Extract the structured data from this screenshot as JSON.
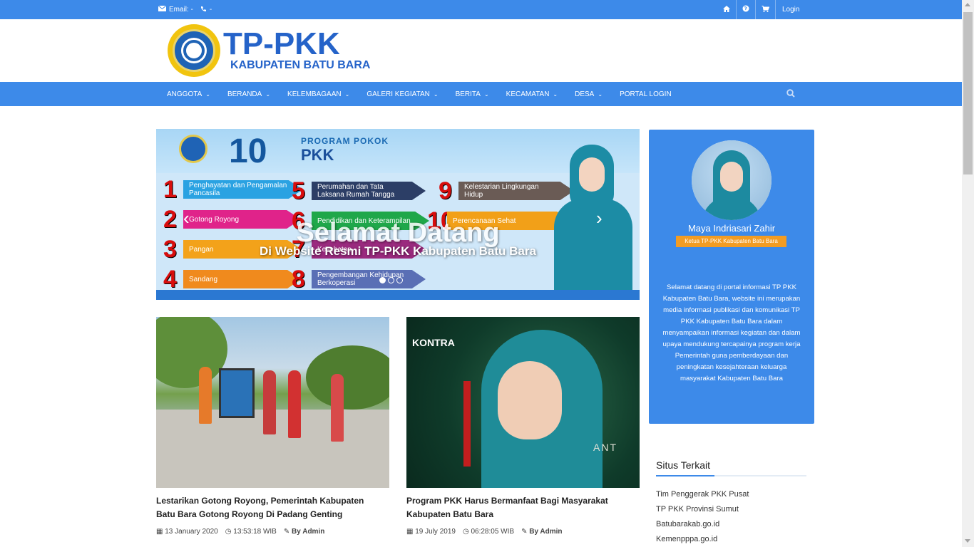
{
  "topbar": {
    "email_label": "Email: -",
    "phone_label": "-",
    "icons": [
      "home-icon",
      "globe-icon",
      "cart-icon"
    ],
    "login_label": "Login"
  },
  "logo": {
    "brand": "TP-PKK",
    "sub": "KABUPATEN BATU BARA"
  },
  "nav": {
    "items": [
      {
        "label": "ANGGOTA",
        "dropdown": true
      },
      {
        "label": "BERANDA",
        "dropdown": true
      },
      {
        "label": "KELEMBAGAAN",
        "dropdown": true
      },
      {
        "label": "GALERI KEGIATAN",
        "dropdown": true
      },
      {
        "label": "BERITA",
        "dropdown": true
      },
      {
        "label": "KECAMATAN",
        "dropdown": true
      },
      {
        "label": "DESA",
        "dropdown": true
      },
      {
        "label": "PORTAL LOGIN",
        "dropdown": false
      }
    ],
    "search_icon": "search-icon"
  },
  "slider": {
    "number": "10",
    "heading1": "PROGRAM POKOK",
    "heading2": "PKK",
    "programs": [
      {
        "n": "1",
        "label": "Penghayatan dan Pengamalan Pancasila",
        "color": "#2aa2e2"
      },
      {
        "n": "2",
        "label": "Gotong Royong",
        "color": "#e0238a"
      },
      {
        "n": "3",
        "label": "Pangan",
        "color": "#f3a21a"
      },
      {
        "n": "4",
        "label": "Sandang",
        "color": "#f08a1d"
      },
      {
        "n": "5",
        "label": "Perumahan dan Tata Laksana Rumah Tangga",
        "color": "#2c3e66"
      },
      {
        "n": "6",
        "label": "Pendidikan dan Keterampilan",
        "color": "#1fa74a"
      },
      {
        "n": "7",
        "label": "Kesehatan",
        "color": "#9a2a7e"
      },
      {
        "n": "8",
        "label": "Pengembangan Kehidupan Berkoperasi",
        "color": "#5a6fb5"
      },
      {
        "n": "9",
        "label": "Kelestarian Lingkungan Hidup",
        "color": "#6a5b55"
      },
      {
        "n": "10",
        "label": "Perencanaan Sehat",
        "color": "#f2a018"
      }
    ],
    "caption_title": "Selamat Datang",
    "caption_sub": "Di Website Resmi TP-PKK Kabupaten Batu Bara",
    "active_slide": 1,
    "slide_count": 3
  },
  "posts": [
    {
      "title": "Lestarikan Gotong Royong, Pemerintah Kabupaten Batu Bara Gotong Royong Di Padang Genting",
      "date": "13 January 2020",
      "time": "13:53:18 WIB",
      "author": "By Admin"
    },
    {
      "title": "Program PKK Harus Bermanfaat Bagi Masyarakat Kabupaten Batu Bara",
      "date": "19 July 2019",
      "time": "06:28:05 WIB",
      "author": "By Admin",
      "image_text": [
        "KONTRA",
        "ANT"
      ]
    }
  ],
  "profile": {
    "name": "Maya Indriasari Zahir",
    "role": "Ketua TP-PKK Kabupaten Batu Bara",
    "description": "Selamat datang di portal informasi TP PKK Kabupaten Batu Bara, website ini merupakan media informasi publikasi dan komunikasi TP PKK Kabupaten Batu Bara dalam menyampaikan informasi kegiatan dan dalam upaya mendukung tercapainya program kerja Pemerintah guna pemberdayaan dan peningkatan kesejahteraan keluarga masyarakat Kabupaten Batu Bara"
  },
  "related": {
    "heading": "Situs Terkait",
    "links": [
      "Tim Penggerak PKK Pusat",
      "TP PKK Provinsi Sumut",
      "Batubarakab.go.id",
      "Kemenpppa.go.id"
    ]
  },
  "colors": {
    "primary": "#3d8ae9",
    "accent_orange": "#f29c23",
    "logo_blue": "#2563c9"
  }
}
